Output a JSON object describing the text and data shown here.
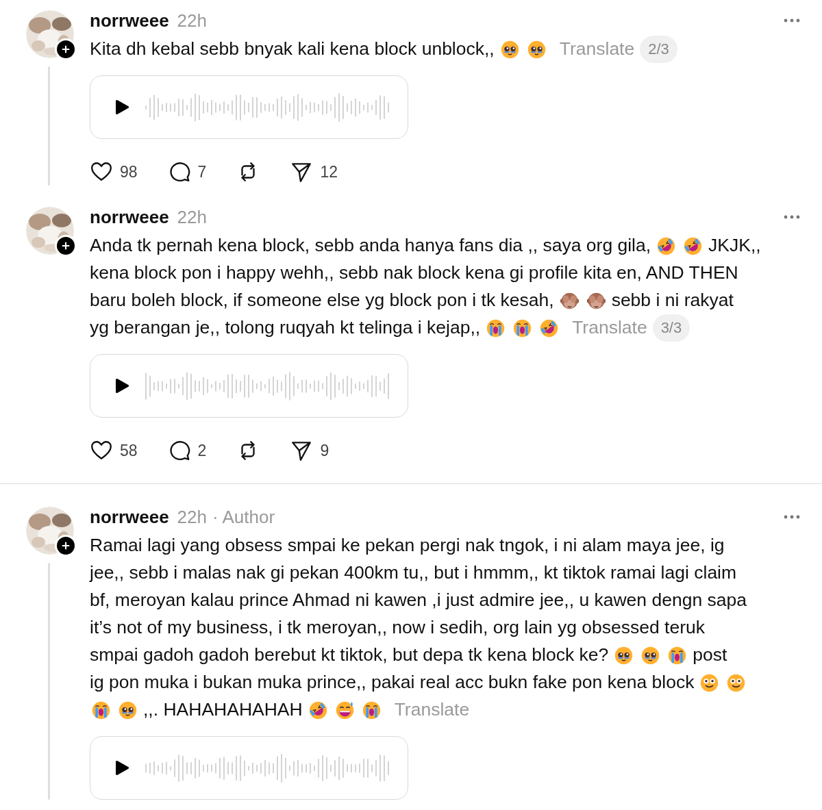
{
  "posts": [
    {
      "username": "norrweee",
      "time": "22h",
      "thread_line": true,
      "divider_after": false,
      "lines": [
        [
          {
            "kind": "text",
            "text": "Kita dh kebal sebb bnyak kali kena block unblock,,"
          },
          {
            "kind": "pleading"
          },
          {
            "kind": "pleading"
          }
        ]
      ],
      "translate": "Translate",
      "translate_count": "2/3",
      "audio": {
        "kind": "voice"
      },
      "actions": [
        {
          "kind": "like",
          "count": "98"
        },
        {
          "kind": "comment",
          "count": "7"
        },
        {
          "kind": "repost"
        },
        {
          "kind": "share",
          "count": "12"
        }
      ]
    },
    {
      "username": "norrweee",
      "time": "22h",
      "thread_line": false,
      "divider_after": true,
      "lines": [
        [
          {
            "kind": "text",
            "text": "Anda tk pernah kena block, sebb anda hanya fans dia ,, saya org gila,"
          },
          {
            "kind": "rofl"
          },
          {
            "kind": "rofl"
          },
          {
            "kind": "text",
            "text": "JKJK,,"
          }
        ],
        [
          {
            "kind": "text",
            "text": "kena block pon i happy wehh,, sebb nak block kena gi profile kita en, AND THEN"
          }
        ],
        [
          {
            "kind": "text",
            "text": "baru boleh block, if someone else yg block pon i tk kesah,"
          },
          {
            "kind": "monkey"
          },
          {
            "kind": "monkey"
          },
          {
            "kind": "text",
            "text": "sebb i ni rakyat"
          }
        ],
        [
          {
            "kind": "text",
            "text": "yg berangan je,, tolong ruqyah kt telinga i kejap,,"
          },
          {
            "kind": "crying"
          },
          {
            "kind": "crying"
          },
          {
            "kind": "rofl"
          }
        ]
      ],
      "translate": "Translate",
      "translate_count": "3/3",
      "audio": {
        "kind": "voice"
      },
      "actions": [
        {
          "kind": "like",
          "count": "58"
        },
        {
          "kind": "comment",
          "count": "2"
        },
        {
          "kind": "repost"
        },
        {
          "kind": "share",
          "count": "9"
        }
      ]
    },
    {
      "username": "norrweee",
      "time": "22h",
      "badge": "· Author",
      "thread_line": true,
      "divider_after": false,
      "lines": [
        [
          {
            "kind": "text",
            "text": "Ramai lagi yang obsess smpai ke pekan pergi nak tngok, i ni alam maya jee, ig"
          }
        ],
        [
          {
            "kind": "text",
            "text": "jee,, sebb i malas nak gi pekan 400km tu,, but i hmmm,, kt tiktok ramai lagi claim"
          }
        ],
        [
          {
            "kind": "text",
            "text": "bf, meroyan kalau prince Ahmad ni kawen ,i just admire jee,, u kawen dengn sapa"
          }
        ],
        [
          {
            "kind": "text",
            "text": "it’s not of my business, i tk meroyan,, now i sedih, org lain yg obsessed teruk"
          }
        ],
        [
          {
            "kind": "text",
            "text": "smpai gadoh gadoh berebut kt tiktok, but depa tk kena block ke?"
          },
          {
            "kind": "pleading"
          },
          {
            "kind": "pleading"
          },
          {
            "kind": "crying"
          },
          {
            "kind": "text",
            "text": "post"
          }
        ],
        [
          {
            "kind": "text",
            "text": "ig pon muka i bukan muka prince,, pakai real acc bukn fake pon kena block"
          },
          {
            "kind": "smile"
          },
          {
            "kind": "smile"
          }
        ],
        [
          {
            "kind": "crying"
          },
          {
            "kind": "pleading"
          },
          {
            "kind": "text",
            "text": ",,. HAHAHAHAHAH"
          },
          {
            "kind": "rofl"
          },
          {
            "kind": "sweat"
          },
          {
            "kind": "crying"
          }
        ]
      ],
      "translate": "Translate",
      "audio": {
        "kind": "voice"
      }
    }
  ]
}
